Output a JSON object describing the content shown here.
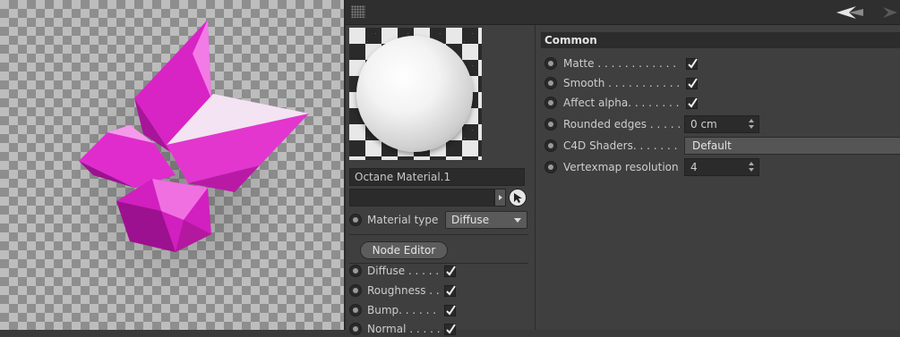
{
  "material": {
    "name": "Octane Material.1",
    "link_value": "",
    "type_label": "Material type",
    "type_value": "Diffuse",
    "node_editor_label": "Node Editor",
    "channels": [
      {
        "label": "Diffuse . . . . .",
        "checked": true
      },
      {
        "label": "Roughness . .",
        "checked": true
      },
      {
        "label": "Bump. . . . . .",
        "checked": true
      },
      {
        "label": "Normal . . . . .",
        "checked": true
      }
    ]
  },
  "common": {
    "title": "Common",
    "matte_label": "Matte . . . . . . . . . . . .",
    "matte_checked": true,
    "smooth_label": "Smooth . . . . . . . . . . .",
    "smooth_checked": true,
    "affect_alpha_label": "Affect alpha. . . . . . . .",
    "affect_alpha_checked": true,
    "rounded_edges_label": "Rounded edges . . . . .",
    "rounded_edges_value": "0 cm",
    "c4d_shaders_label": "C4D Shaders. . . . . . .",
    "c4d_shaders_value": "Default",
    "vertexmap_label": "Vertexmap resolution",
    "vertexmap_value": "4"
  },
  "colors": {
    "crystal": "#e020c8",
    "panel_bg": "#3f3f3f",
    "field_bg": "#2b2b2b"
  },
  "icons": [
    "grip-icon",
    "nav-back-icon",
    "nav-forward-icon",
    "object-picker-icon",
    "checkmark-icon",
    "radio-icon"
  ]
}
